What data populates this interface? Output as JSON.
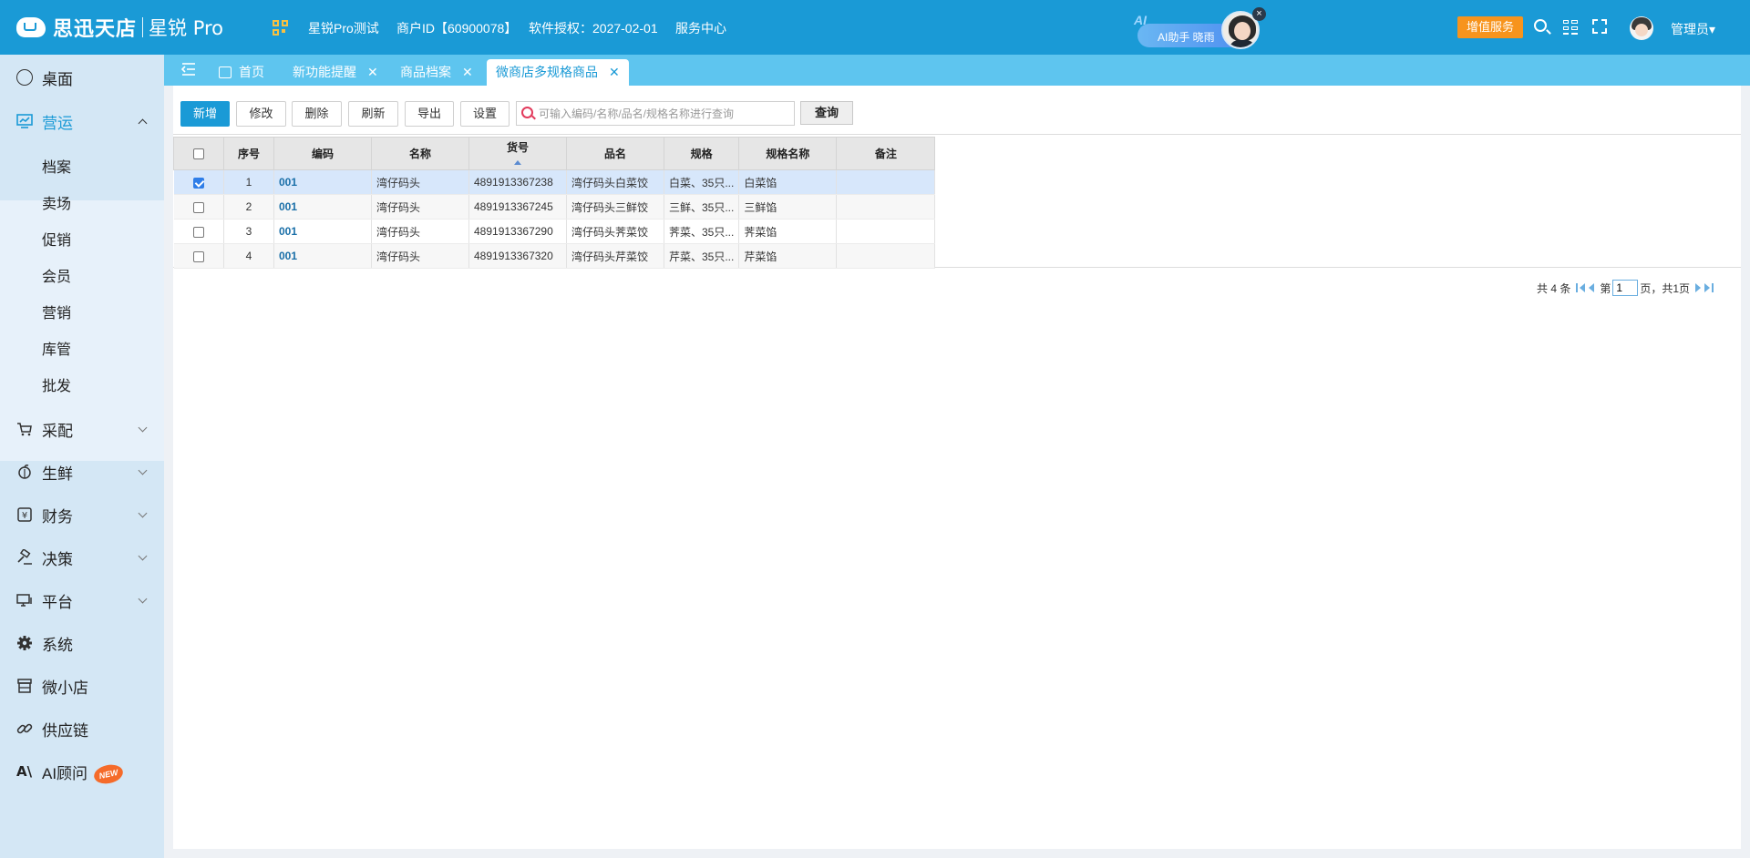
{
  "header": {
    "logo_brand": "思迅天店",
    "logo_product": "星锐 Pro",
    "store_name": "星锐Pro测试",
    "merchant_id": "商户ID【60900078】",
    "license": "软件授权：2027-02-01",
    "service_center": "服务中心",
    "ai_badge_text": "AI助手 晓雨",
    "vip_button": "增值服务",
    "user_name": "管理员▾"
  },
  "sidebar": {
    "items": [
      {
        "label": "桌面",
        "icon": "user-circle-icon"
      },
      {
        "label": "营运",
        "icon": "monitor-chart-icon"
      },
      {
        "label": "采配",
        "icon": "cart-icon"
      },
      {
        "label": "生鲜",
        "icon": "fruit-icon"
      },
      {
        "label": "财务",
        "icon": "yen-icon"
      },
      {
        "label": "决策",
        "icon": "hammer-icon"
      },
      {
        "label": "平台",
        "icon": "desktop-icon"
      },
      {
        "label": "系统",
        "icon": "gear-icon"
      },
      {
        "label": "微小店",
        "icon": "shop-icon"
      },
      {
        "label": "供应链",
        "icon": "link-icon"
      },
      {
        "label": "AI顾问",
        "icon": "ai-icon"
      }
    ],
    "sub_items": [
      "档案",
      "卖场",
      "促销",
      "会员",
      "营销",
      "库管",
      "批发"
    ],
    "new_badge": "NEW"
  },
  "tabs": [
    {
      "label": "首页"
    },
    {
      "label": "新功能提醒"
    },
    {
      "label": "商品档案"
    },
    {
      "label": "微商店多规格商品"
    }
  ],
  "toolbar": {
    "add": "新增",
    "edit": "修改",
    "delete": "删除",
    "refresh": "刷新",
    "export": "导出",
    "settings": "设置",
    "search_placeholder": "可输入编码/名称/品名/规格名称进行查询",
    "query": "查询"
  },
  "table": {
    "headers": [
      "序号",
      "编码",
      "名称",
      "货号",
      "品名",
      "规格",
      "规格名称",
      "备注"
    ],
    "rows": [
      {
        "selected": true,
        "cells": [
          "1",
          "001",
          "湾仔码头",
          "4891913367238",
          "湾仔码头白菜饺",
          "白菜、35只...",
          "白菜馅",
          ""
        ]
      },
      {
        "selected": false,
        "cells": [
          "2",
          "001",
          "湾仔码头",
          "4891913367245",
          "湾仔码头三鲜饺",
          "三鲜、35只...",
          "三鲜馅",
          ""
        ]
      },
      {
        "selected": false,
        "cells": [
          "3",
          "001",
          "湾仔码头",
          "4891913367290",
          "湾仔码头荠菜饺",
          "荠菜、35只...",
          "荠菜馅",
          ""
        ]
      },
      {
        "selected": false,
        "cells": [
          "4",
          "001",
          "湾仔码头",
          "4891913367320",
          "湾仔码头芹菜饺",
          "芹菜、35只...",
          "芹菜馅",
          ""
        ]
      }
    ]
  },
  "pager": {
    "total": "共 4 条",
    "page_prefix": "第",
    "page_value": "1",
    "page_suffix": "页，共1页"
  }
}
